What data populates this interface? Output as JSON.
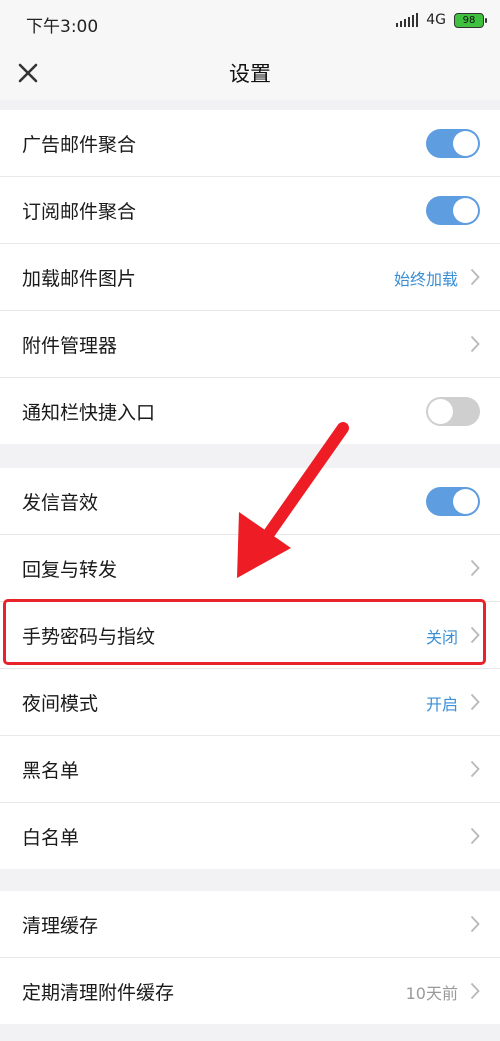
{
  "status": {
    "time": "下午3:00",
    "network": "4G",
    "battery": "98"
  },
  "nav": {
    "title": "设置"
  },
  "groups": [
    {
      "items": [
        {
          "label": "广告邮件聚合",
          "type": "toggle",
          "on": true
        },
        {
          "label": "订阅邮件聚合",
          "type": "toggle",
          "on": true
        },
        {
          "label": "加载邮件图片",
          "type": "link",
          "value": "始终加载"
        },
        {
          "label": "附件管理器",
          "type": "link"
        },
        {
          "label": "通知栏快捷入口",
          "type": "toggle",
          "on": false
        }
      ]
    },
    {
      "items": [
        {
          "label": "发信音效",
          "type": "toggle",
          "on": true
        },
        {
          "label": "回复与转发",
          "type": "link"
        },
        {
          "label": "手势密码与指纹",
          "type": "link",
          "value": "关闭"
        },
        {
          "label": "夜间模式",
          "type": "link",
          "value": "开启"
        },
        {
          "label": "黑名单",
          "type": "link"
        },
        {
          "label": "白名单",
          "type": "link"
        }
      ]
    },
    {
      "items": [
        {
          "label": "清理缓存",
          "type": "link"
        },
        {
          "label": "定期清理附件缓存",
          "type": "link",
          "value": "10天前"
        }
      ]
    }
  ],
  "colors": {
    "accent": "#3b8fd6",
    "toggle_on": "#5d9de0",
    "toggle_off": "#cfcfcf",
    "highlight": "#e8242a"
  }
}
